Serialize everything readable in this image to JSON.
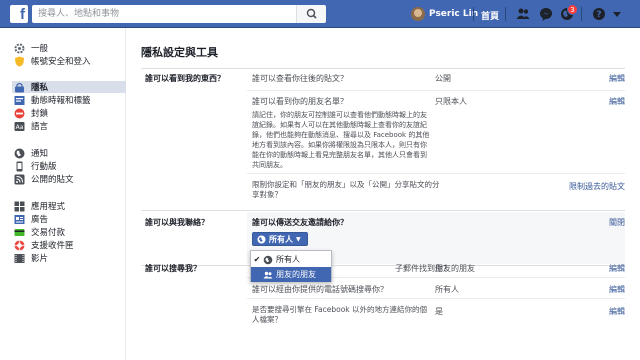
{
  "topbar": {
    "logo": "f",
    "search_placeholder": "搜尋人、地點和事物",
    "username": "Pseric Lin",
    "home": "首頁",
    "notification_count": "3"
  },
  "sidebar": {
    "items": [
      {
        "label": "一般",
        "icon": "gear-icon"
      },
      {
        "label": "帳號安全和登入",
        "icon": "shield-icon"
      },
      {
        "label": "隱私",
        "icon": "lock-icon",
        "active": true
      },
      {
        "label": "動態時報和標籤",
        "icon": "timeline-icon"
      },
      {
        "label": "封鎖",
        "icon": "block-icon"
      },
      {
        "label": "語言",
        "icon": "language-icon"
      },
      {
        "label": "通知",
        "icon": "globe-icon"
      },
      {
        "label": "行動版",
        "icon": "mobile-icon"
      },
      {
        "label": "公開的貼文",
        "icon": "rss-icon"
      },
      {
        "label": "應用程式",
        "icon": "apps-icon"
      },
      {
        "label": "廣告",
        "icon": "ads-icon"
      },
      {
        "label": "交易付款",
        "icon": "payments-icon"
      },
      {
        "label": "支援收件匣",
        "icon": "support-icon"
      },
      {
        "label": "影片",
        "icon": "video-icon"
      }
    ]
  },
  "main": {
    "title": "隱私設定與工具",
    "sections": [
      {
        "label": "誰可以看到我的東西？",
        "rows": [
          {
            "question": "誰可以查看你往後的貼文？",
            "value": "公開",
            "action": "編輯"
          },
          {
            "question": "誰可以看到你的朋友名單？",
            "description": "請記住，你的朋友可控制誰可以查看他們動態時報上的友誼紀錄。如果有人可以在其他動態時報上查看你的友誼紀錄，他們也能夠在動態消息、搜尋以及 Facebook 的其他地方看到該內容。如果你將權限設為只限本人，則只有你能在你的動態時報上看見完整朋友名單，其他人只會看到共同朋友。",
            "value": "只限本人",
            "action": "編輯"
          },
          {
            "question": "限制你設定和「朋友的朋友」以及「公開」分享貼文的分享對象？",
            "value": "",
            "action": "限制過去的貼文"
          }
        ]
      },
      {
        "label": "誰可以與我聯絡？",
        "rows": [
          {
            "question": "誰可以傳送交友邀請給你？",
            "value": "",
            "action": "關閉",
            "dropdown": "所有人"
          }
        ]
      },
      {
        "label": "誰可以搜尋我？",
        "rows": [
          {
            "question": "子郵件找到你？",
            "value": "朋友的朋友",
            "action": "編輯"
          },
          {
            "question": "誰可以經由你提供的電話號碼搜尋你？",
            "value": "所有人",
            "action": "編輯"
          },
          {
            "question": "是否要搜尋引擎在 Facebook 以外的地方連結你的個人檔案？",
            "value": "是",
            "action": "編輯"
          }
        ]
      }
    ],
    "dropdown_menu": [
      {
        "label": "所有人",
        "icon": "globe-icon",
        "checked": true
      },
      {
        "label": "朋友的朋友",
        "icon": "friends-icon",
        "checked": false,
        "highlighted": true
      }
    ]
  },
  "colors": {
    "brand": "#4267b2",
    "link": "#365899",
    "badge": "#fa3e3e"
  }
}
